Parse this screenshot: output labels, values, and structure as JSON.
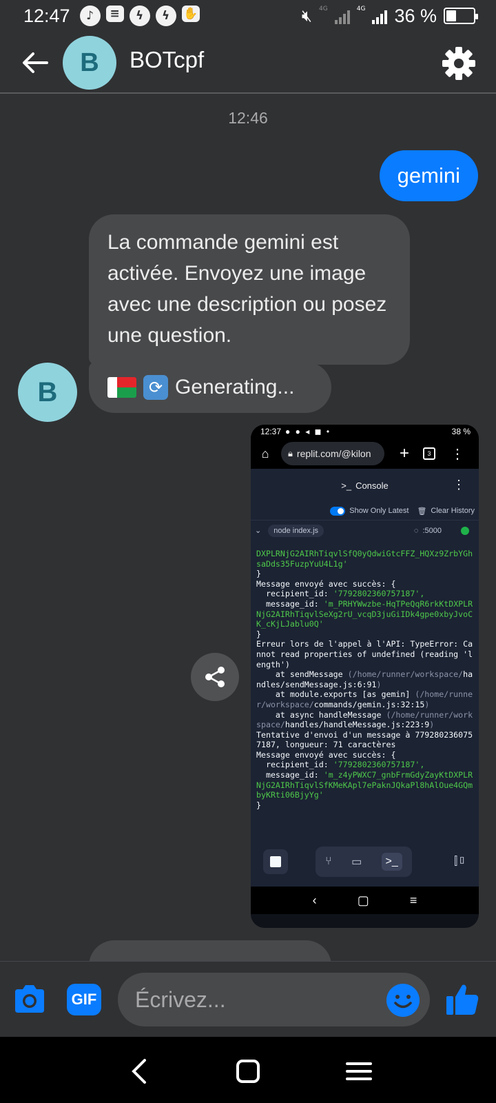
{
  "status_bar": {
    "time": "12:47",
    "net1": "4G",
    "net2": "4G",
    "battery": "36 %",
    "battery_level": 0.36
  },
  "header": {
    "avatar_letter": "B",
    "title": "BOTcpf"
  },
  "conversation": {
    "timestamp": "12:46",
    "outgoing_text": "gemini",
    "reply_text": "La commande gemini est activée. Envoyez une image avec une description ou posez une question.",
    "generating_text": "Generating...",
    "avatar_letter": "B"
  },
  "shared_image": {
    "time": "12:37",
    "battery": "38 %",
    "url": "replit.com/@kilon",
    "console_title": "Console",
    "show_latest": "Show Only Latest",
    "clear_history": "Clear History",
    "process": "node index.js",
    "port": ":5000",
    "log": [
      {
        "t": "DXPLRNjG2AIRhTiqvlSfQ0yQdwiGtcFFZ_HQXz9ZrbYGhsaDds35FuzpYuU4L1g'",
        "c": "g"
      },
      {
        "t": "}",
        "c": ""
      },
      {
        "t": "Message envoyé avec succès: {",
        "c": ""
      },
      {
        "t": "  recipient_id: ",
        "c": "",
        "v": "'7792802360757187',"
      },
      {
        "t": "  message_id: ",
        "c": "",
        "v": "'m_PRHYWwzbe-HqTPeQqR6rkKtDXPLRNjG2AIRhTiqvlSeXg2rU_vcqD3juGiIDk4gpe0xbyJvoCK_cKjLJablu0Q'"
      },
      {
        "t": "}",
        "c": ""
      },
      {
        "t": "Erreur lors de l'appel à l'API: TypeError: Cannot read properties of undefined (reading 'length')",
        "c": ""
      },
      {
        "t": "    at sendMessage ",
        "c": "",
        "p": "(/home/runner/workspace/",
        "h": "handles/sendMessage.js:6:91",
        "e": ")"
      },
      {
        "t": "    at module.exports [as gemin] ",
        "c": "",
        "p": "(/home/runner/workspace/",
        "h": "commands/gemin.js:32:15",
        "e": ")"
      },
      {
        "t": "",
        "c": ""
      },
      {
        "t": "    at async handleMessage ",
        "c": "",
        "p": "(/home/runner/workspace/",
        "h": "handles/handleMessage.js:223:9",
        "e": ")"
      },
      {
        "t": "Tentative d'envoi d'un message à 7792802360757187, longueur: 71 caractères",
        "c": ""
      },
      {
        "t": "Message envoyé avec succès: {",
        "c": ""
      },
      {
        "t": "  recipient_id: ",
        "c": "",
        "v": "'7792802360757187',"
      },
      {
        "t": "  message_id: ",
        "c": "",
        "v": "'m_z4yPWXC7_gnbFrmGdyZayKtDXPLRNjG2AIRhTiqvlSfKMeKApl7ePaknJQkaPl8hAlOue4GQmbyKRti06BjyYg'"
      },
      {
        "t": "}",
        "c": ""
      }
    ]
  },
  "composer": {
    "placeholder": "Écrivez...",
    "gif_label": "GIF"
  },
  "colors": {
    "accent": "#0a7cff",
    "background": "#303133",
    "bubble": "#48494b"
  }
}
